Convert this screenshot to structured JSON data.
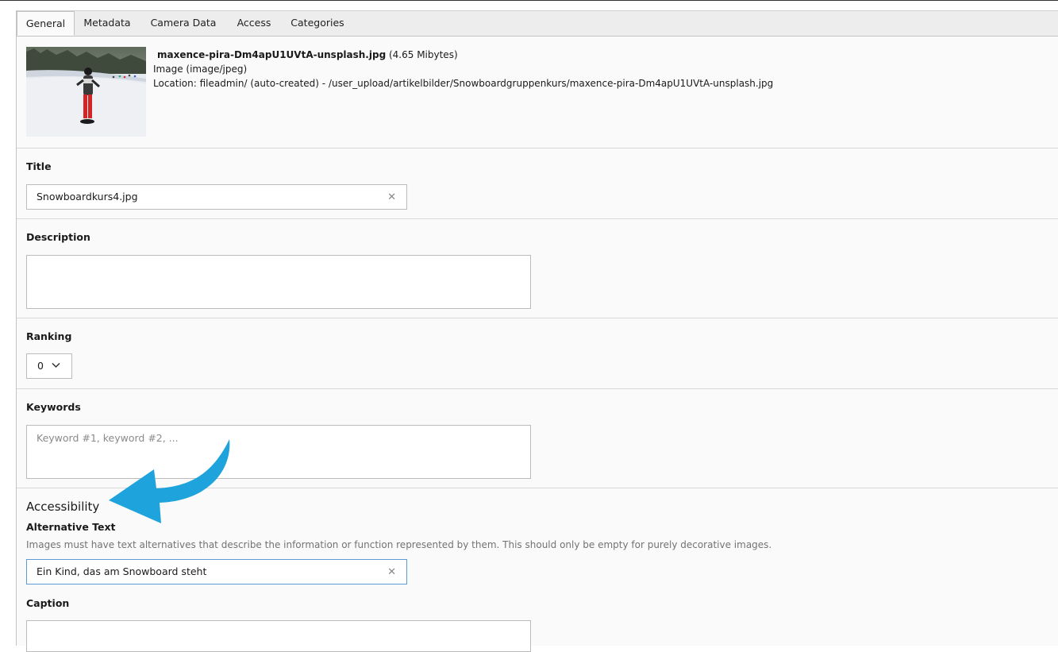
{
  "tabs": [
    "General",
    "Metadata",
    "Camera Data",
    "Access",
    "Categories"
  ],
  "file": {
    "name": "maxence-pira-Dm4apU1UVtA-unsplash.jpg",
    "size": "(4.65 Mibytes)",
    "type": "Image (image/jpeg)",
    "location": "Location: fileadmin/ (auto-created) - /user_upload/artikelbilder/Snowboardgruppenkurs/maxence-pira-Dm4apU1UVtA-unsplash.jpg"
  },
  "fields": {
    "title": {
      "label": "Title",
      "value": "Snowboardkurs4.jpg"
    },
    "description": {
      "label": "Description",
      "value": ""
    },
    "ranking": {
      "label": "Ranking",
      "value": "0"
    },
    "keywords": {
      "label": "Keywords",
      "placeholder": "Keyword #1, keyword #2, ..."
    },
    "accessibility": {
      "section_title": "Accessibility",
      "alt_label": "Alternative Text",
      "alt_hint": "Images must have text alternatives that describe the information or function represented by them. This should only be empty for purely decorative images.",
      "alt_value": "Ein Kind, das am Snowboard steht"
    },
    "caption": {
      "label": "Caption"
    }
  },
  "icons": {
    "clear": "close-icon",
    "select": "chevron-down-icon",
    "annotation": "curved-arrow-icon"
  },
  "colors": {
    "annotation_arrow": "#1ea3dc",
    "focus_border": "#5b9bd5"
  }
}
